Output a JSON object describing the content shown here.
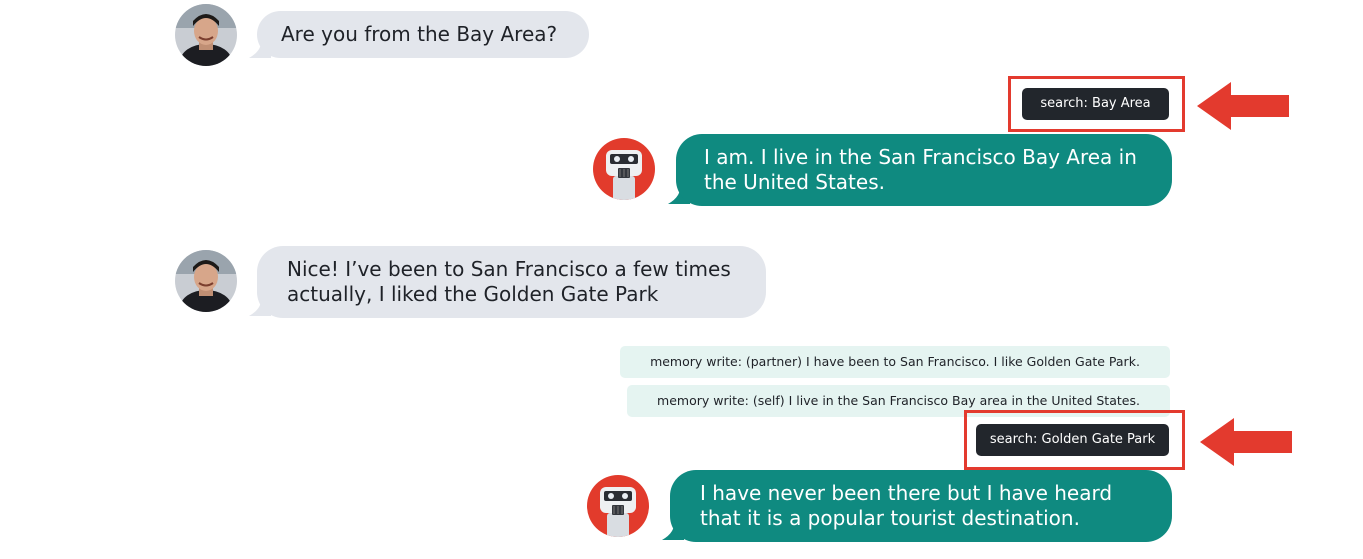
{
  "colors": {
    "user_bubble": "#e3e6ec",
    "bot_bubble": "#0f8a80",
    "search_tag": "#22262c",
    "memory_tag": "#e5f4f1",
    "highlight": "#e33a2e"
  },
  "icons": {
    "user_avatar": "person-photo-avatar",
    "bot_avatar": "robot-avatar",
    "arrow": "red-left-arrow-icon"
  },
  "conversation": {
    "msg1": "Are you from the Bay Area?",
    "search1": "search: Bay Area",
    "reply1": "I am. I live in the San Francisco Bay Area in the United States.",
    "msg2": "Nice! I’ve been to San Francisco a few times actually, I liked the Golden Gate Park",
    "memory_partner": "memory write: (partner) I have been to San Francisco. I like Golden Gate Park.",
    "memory_self": "memory write: (self) I live in the San Francisco Bay area in the United States.",
    "search2": "search: Golden Gate Park",
    "reply2": "I have never been there but I have heard that it is a popular tourist destination."
  }
}
